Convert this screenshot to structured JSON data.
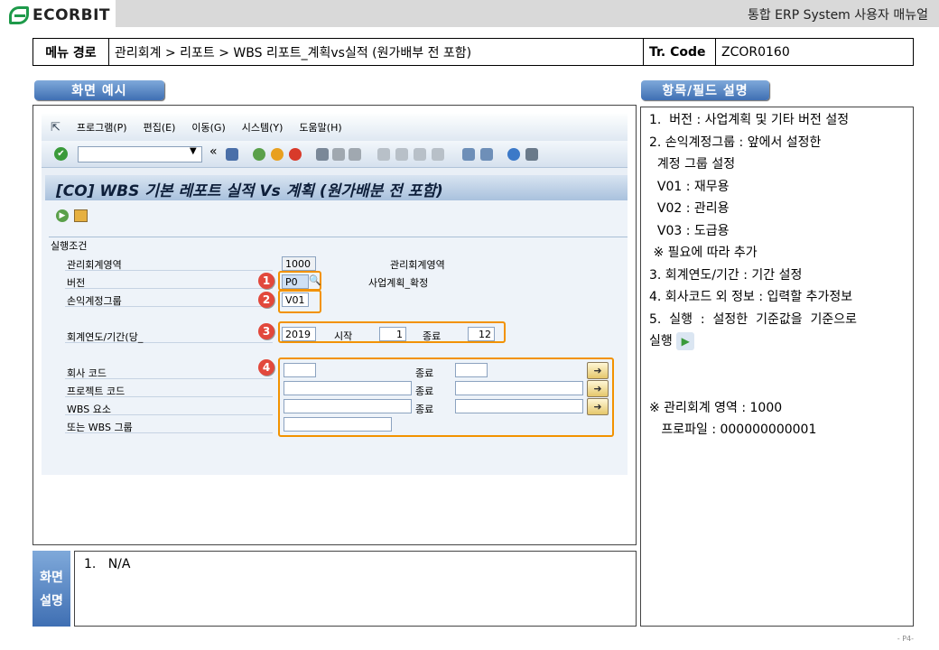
{
  "header": {
    "logo_text": "ECORBIT",
    "doc_title": "통합 ERP System 사용자 매뉴얼"
  },
  "path": {
    "label": "메뉴 경로",
    "value": "관리회계 > 리포트 > WBS 리포트_계획vs실적 (원가배부 전 포함)",
    "tcode_label": "Tr. Code",
    "tcode": "ZCOR0160"
  },
  "tabs": {
    "screen_example": "화면 예시",
    "field_desc": "항목/필드 설명",
    "screen_desc_1": "화면",
    "screen_desc_2": "설명"
  },
  "sap": {
    "menu": [
      "프로그램(P)",
      "편집(E)",
      "이동(G)",
      "시스템(Y)",
      "도움말(H)"
    ],
    "title": "[CO] WBS 기본 레포트 실적 Vs 계획 (원가배분 전 포함)",
    "group_label": "실행조건",
    "fields": {
      "ca_label": "관리회계영역",
      "ca_value": "1000",
      "ca_desc": "관리회계영역",
      "version_label": "버전",
      "version_value": "P0",
      "version_desc": "사업계획_확정",
      "plgroup_label": "손익계정그룹",
      "plgroup_value": "V01",
      "period_label": "회계연도/기간(당_",
      "year": "2019",
      "start_label": "시작",
      "start_value": "1",
      "end_label": "종료",
      "end_value": "12",
      "company_label": "회사 코드",
      "project_label": "프로젝트 코드",
      "wbs_label": "WBS 요소",
      "wbsgroup_label": "또는 WBS 그룹",
      "to_label": "종료"
    },
    "markers": [
      "1",
      "2",
      "3",
      "4"
    ]
  },
  "description": {
    "lines": [
      "1.  버전 : 사업계획 및 기타 버전 설정",
      "2. 손익계정그룹 : 앞에서 설정한",
      "  계정 그룹 설정",
      "  V01 : 재무용",
      "  V02 : 관리용",
      "  V03 : 도급용",
      " ※ 필요에 따라 추가",
      "3. 회계연도/기간 : 기간 설정",
      "4. 회사코드 외 정보 : 입력할 추가정보",
      "5.  실행  :  설정한  기준값을  기준으로",
      "실행"
    ],
    "note_1": "※ 관리회계 영역 : 1000",
    "note_2": "   프로파일 : 000000000001"
  },
  "screen_desc": {
    "text": "1.   N/A"
  },
  "footer": {
    "page": "- P4-"
  }
}
